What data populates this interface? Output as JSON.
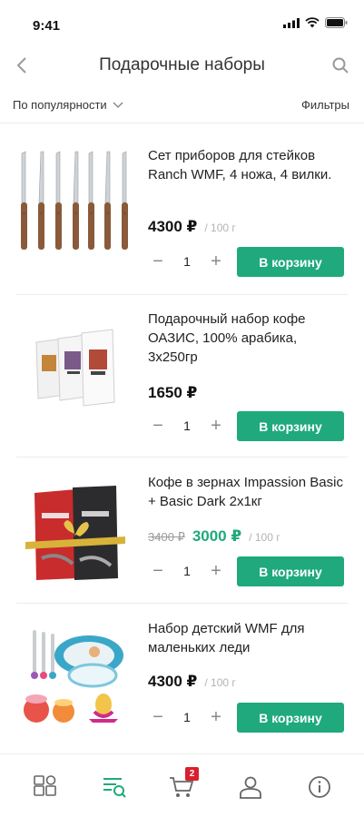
{
  "status_bar": {
    "time": "9:41"
  },
  "header": {
    "title": "Подарочные наборы"
  },
  "sortbar": {
    "sort_label": "По популярности",
    "filters_label": "Фильтры"
  },
  "products": [
    {
      "name": "Сет приборов для стейков Ranch WMF, 4 ножа, 4 вилки.",
      "price": "4300 ₽",
      "old_price": "",
      "unit": "/ 100 г",
      "quantity": "1",
      "cart_label": "В корзину"
    },
    {
      "name": "Подарочный набор кофе ОАЗИС, 100% арабика, 3x250гр",
      "price": "1650 ₽",
      "old_price": "",
      "unit": "",
      "quantity": "1",
      "cart_label": "В корзину"
    },
    {
      "name": "Кофе в зернах Impassion Basic + Basic Dark 2x1кг",
      "price": "3000 ₽",
      "old_price": "3400 ₽",
      "unit": "/ 100 г",
      "quantity": "1",
      "cart_label": "В корзину"
    },
    {
      "name": "Набор детский WMF для маленьких леди",
      "price": "4300 ₽",
      "old_price": "",
      "unit": "/ 100 г",
      "quantity": "1",
      "cart_label": "В корзину"
    }
  ],
  "tabbar": {
    "items": [
      {
        "icon": "catalog-grid-icon"
      },
      {
        "icon": "search-list-icon"
      },
      {
        "icon": "cart-icon",
        "badge": "2"
      },
      {
        "icon": "profile-icon"
      },
      {
        "icon": "info-icon"
      }
    ]
  },
  "colors": {
    "accent": "#1fa97d",
    "badge": "#d9202e"
  }
}
